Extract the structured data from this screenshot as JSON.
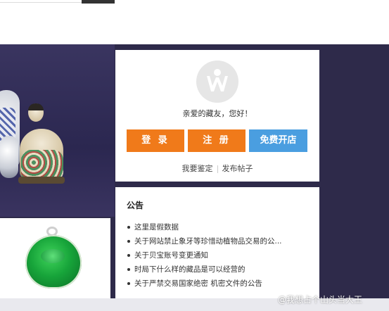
{
  "login": {
    "greeting": "亲爱的藏友，您好！",
    "login_button": "登 录",
    "register_button": "注 册",
    "open_store_button": "免费开店",
    "links": [
      "我要鉴定",
      "发布帖子"
    ]
  },
  "notice": {
    "title": "公告",
    "items": [
      "这里是假数据",
      "关于网站禁止象牙等珍惜动植物品交易的公...",
      "关于贝宝账号变更通知",
      "时局下什么样的藏品是可以经营的",
      "关于严禁交易国家绝密 机密文件的公告"
    ]
  },
  "watermark": "@我想占个山头当大王",
  "colors": {
    "banner": "#2e2a4a",
    "orange_button": "#f07a1a",
    "blue_button": "#4a9ee0",
    "jade": "#17a43a"
  },
  "icons": [
    "site-logo-icon"
  ]
}
